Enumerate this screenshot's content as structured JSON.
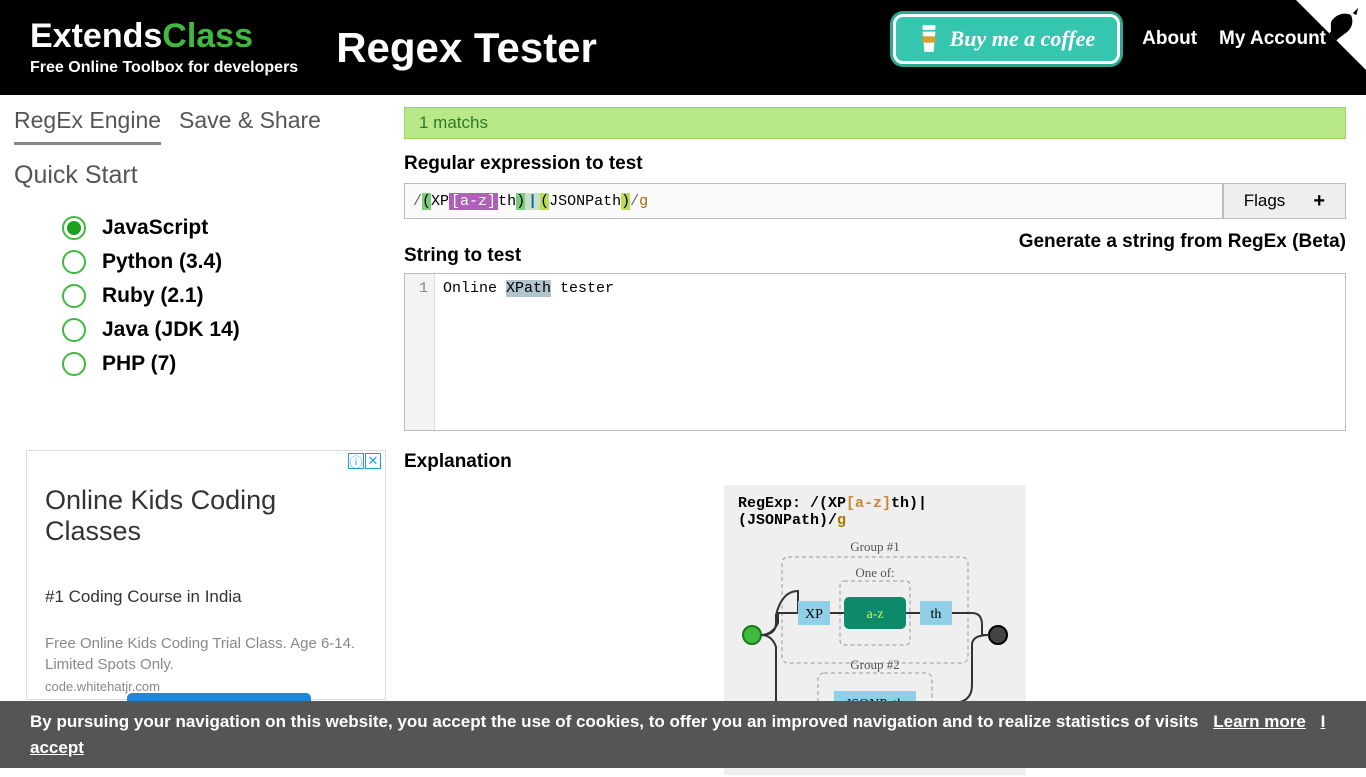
{
  "header": {
    "brand_prefix": "Extends",
    "brand_suffix": "Class",
    "brand_sub": "Free Online Toolbox for developers",
    "page_title": "Regex Tester",
    "coffee_label": "Buy me a coffee",
    "links": {
      "about": "About",
      "account": "My Account"
    }
  },
  "tabs": {
    "engine": "RegEx Engine",
    "save": "Save & Share"
  },
  "quickstart": "Quick Start",
  "engines": [
    {
      "label": "JavaScript",
      "checked": true
    },
    {
      "label": "Python (3.4)",
      "checked": false
    },
    {
      "label": "Ruby (2.1)",
      "checked": false
    },
    {
      "label": "Java (JDK 14)",
      "checked": false
    },
    {
      "label": "PHP (7)",
      "checked": false
    }
  ],
  "ad": {
    "title": "Online Kids Coding Classes",
    "line1": "#1 Coding Course in India",
    "line2": "Free Online Kids Coding Trial Class. Age 6-14.",
    "line3": "Limited Spots Only.",
    "url": "code.whitehatjr.com"
  },
  "match_status": "1 matchs",
  "labels": {
    "regex": "Regular expression to test",
    "flags": "Flags",
    "flags_plus": "+",
    "test": "String to test",
    "generate": "Generate a string from RegEx (Beta)",
    "explanation": "Explanation"
  },
  "regex": {
    "open_slash": "/",
    "g1_open": "(",
    "xp": "XP",
    "class": "[a-z]",
    "th": "th",
    "g1_close": ")",
    "pipe": "|",
    "g2_open": "(",
    "jsonpath": "JSONPath",
    "g2_close": ")",
    "close_slash": "/",
    "flag": "g"
  },
  "test_string": {
    "line_no": "1",
    "before": "Online ",
    "match": "XPath",
    "after": " tester"
  },
  "diagram": {
    "head_prefix": "RegExp: ",
    "group1": "Group #1",
    "group2": "Group #2",
    "oneof": "One of:",
    "xp": "XP",
    "az": "a-z",
    "th": "th",
    "jsonpath": "JSONPath"
  },
  "cookie": {
    "text": "By pursuing your navigation on this website, you accept the use of cookies, to offer you an improved navigation and to realize statistics of visits",
    "learn": "Learn more",
    "accept": "I accept"
  }
}
